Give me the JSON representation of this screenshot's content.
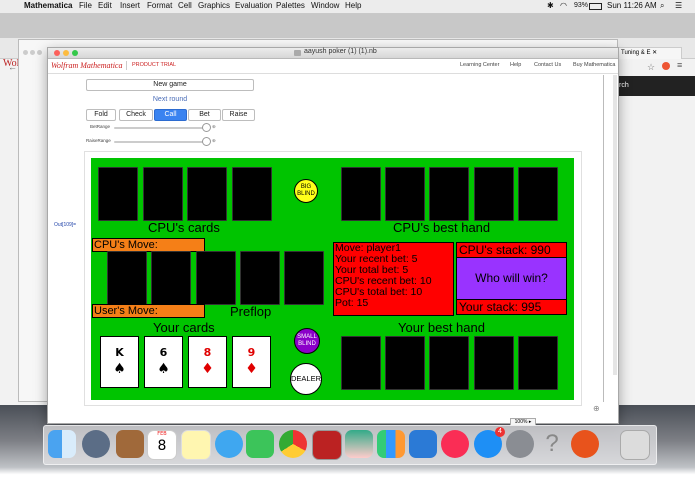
{
  "menubar": {
    "app": "Mathematica",
    "items": [
      "File",
      "Edit",
      "Insert",
      "Format",
      "Cell",
      "Graphics",
      "Evaluation",
      "Palettes",
      "Window",
      "Help"
    ],
    "battery": "93%",
    "clock": "Sun 11:26 AM"
  },
  "browser": {
    "tab_right": "Tuning & E",
    "side_text": "rch",
    "wolfram_text": "Wolfran"
  },
  "window": {
    "title": "aayush poker (1) (1).nb",
    "logo": "Wolfram Mathematica",
    "trial": "PRODUCT TRIAL",
    "links": [
      "Learning Center",
      "Help",
      "Contact Us",
      "Buy Mathematica"
    ],
    "zoom": "100%",
    "cell_label": "Out[109]="
  },
  "controls": {
    "new_game": "New game",
    "next_round": "Next round",
    "buttons": [
      "Fold",
      "Check",
      "Call",
      "Bet",
      "Raise"
    ],
    "bet_range": "BetRange",
    "raise_range": "RaiseRange",
    "bet_value": 0.85,
    "raise_value": 0.85
  },
  "game": {
    "cpu_cards_label": "CPU's cards",
    "cpu_best_label": "CPU's best hand",
    "cpu_move_label": "CPU's Move:",
    "user_move_label": "User's Move:",
    "stage": "Preflop",
    "your_cards_label": "Your cards",
    "your_best_label": "Your best hand",
    "big_blind": "BIG BLIND",
    "small_blind": "SMALL BLIND",
    "dealer": "DEALER",
    "info": [
      "Move: player1",
      "Your recent bet: 5",
      "Your total bet: 5",
      "CPU's recent bet: 10",
      "CPU's total bet: 10",
      "Pot: 15"
    ],
    "cpu_stack": "CPU's stack: 990",
    "who_wins": "Who will win?",
    "your_stack": "Your stack: 995",
    "your_cards": [
      {
        "rank": "K",
        "suit": "♠",
        "color": "#000000"
      },
      {
        "rank": "6",
        "suit": "♠",
        "color": "#000000"
      },
      {
        "rank": "8",
        "suit": "♦",
        "color": "#e00000"
      },
      {
        "rank": "9",
        "suit": "♦",
        "color": "#e00000"
      }
    ]
  },
  "dock": {
    "calendar_month": "FEB",
    "calendar_day": "8",
    "badge": "4"
  }
}
